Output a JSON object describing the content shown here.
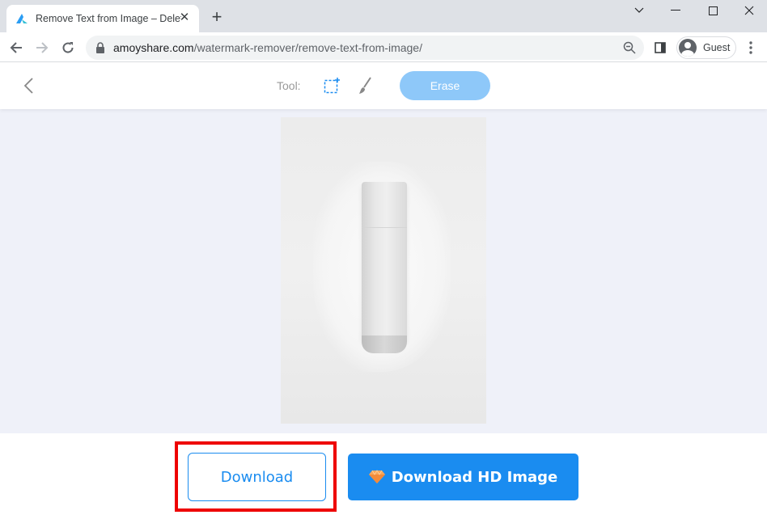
{
  "browser": {
    "tab_title": "Remove Text from Image – Delete Text from Photo",
    "url_domain": "amoyshare.com",
    "url_path": "/watermark-remover/remove-text-from-image/",
    "profile_name": "Guest"
  },
  "app": {
    "tool_label": "Tool:",
    "tools": [
      {
        "name": "rectangle-select",
        "active": true
      },
      {
        "name": "brush",
        "active": false
      }
    ],
    "erase_label": "Erase",
    "download_label": "Download",
    "download_hd_label": "Download HD Image"
  },
  "colors": {
    "accent": "#1a8cf0",
    "erase_disabled": "#8ec8f9",
    "highlight": "#ee0000",
    "canvas_bg": "#eff1f9"
  }
}
